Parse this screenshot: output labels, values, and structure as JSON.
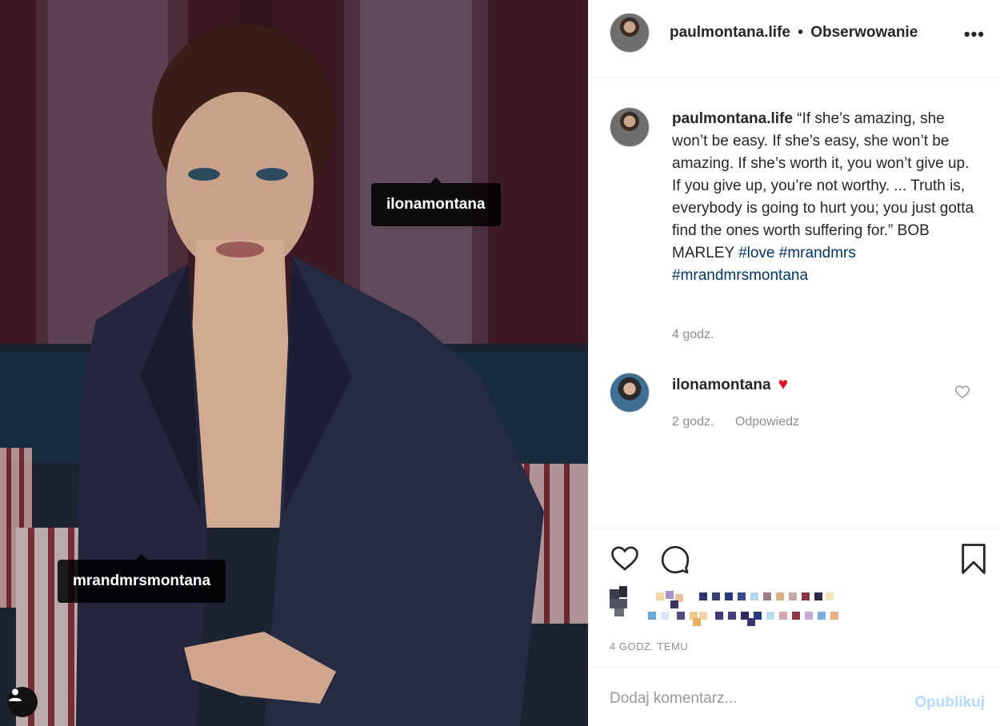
{
  "post": {
    "author": "paulmontana.life",
    "separator": "•",
    "follow_status": "Obserwowanie",
    "more_label": "•••"
  },
  "photo_tags": [
    {
      "username": "ilonamontana"
    },
    {
      "username": "mrandmrsmontana"
    }
  ],
  "caption": {
    "username": "paulmontana.life",
    "text": "“If she’s amazing, she won’t be easy. If she’s easy, she won’t be amazing. If she’s worth it, you won’t give up. If you give up, you’re not worthy. ... Truth is, everybody is going to hurt you; you just gotta find the ones worth suffering for.” BOB MARLEY",
    "hashtags": [
      "#love",
      "#mrandmrs",
      "#mrandmrsmontana"
    ],
    "time": "4 godz."
  },
  "comments": [
    {
      "username": "ilonamontana",
      "emoji": "♥",
      "time": "2 godz.",
      "reply_label": "Odpowiedz"
    }
  ],
  "footer": {
    "timestamp": "4 GODZ. TEMU",
    "comment_placeholder": "Dodaj komentarz...",
    "publish_label": "Opublikuj"
  },
  "colors": {
    "hashtag": "#003569",
    "muted": "#8e8e8e",
    "publish_disabled": "#b3dbff",
    "heart": "#e0102a"
  }
}
